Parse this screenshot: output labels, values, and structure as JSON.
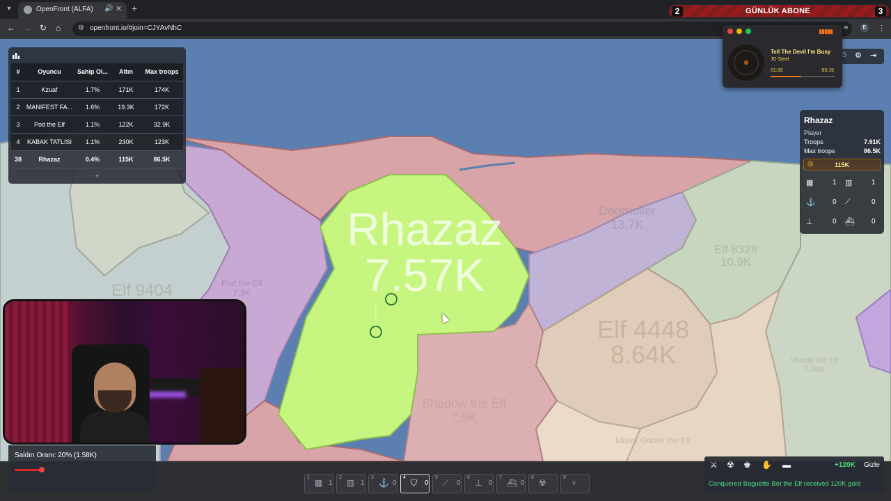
{
  "browser": {
    "tab_title": "OpenFront (ALFA)",
    "url": "openfront.io/#join=CJYAvNhC",
    "profile_initial": "E"
  },
  "banner": {
    "left_number": "2",
    "label": "GÜNLÜK ABONE",
    "right_number": "3"
  },
  "leaderboard": {
    "columns": [
      "#",
      "Oyuncu",
      "Sahip Ol...",
      "Altın",
      "Max troops"
    ],
    "rows": [
      {
        "rank": "1",
        "player": "Kzuaf",
        "owned": "1.7%",
        "gold": "171K",
        "max_troops": "174K"
      },
      {
        "rank": "2",
        "player": "MANIFEST FA...",
        "owned": "1.6%",
        "gold": "19.3K",
        "max_troops": "172K"
      },
      {
        "rank": "3",
        "player": "Pod the Elf",
        "owned": "1.1%",
        "gold": "122K",
        "max_troops": "32.9K"
      },
      {
        "rank": "4",
        "player": "KABAK TATLISI",
        "owned": "1.1%",
        "gold": "230K",
        "max_troops": "123K"
      },
      {
        "rank": "38",
        "player": "Rhazaz",
        "owned": "0.4%",
        "gold": "115K",
        "max_troops": "86.5K"
      }
    ],
    "more_label": "+"
  },
  "music": {
    "song": "Tell The Devil I'm Busy",
    "artist": "JD Steel",
    "current_time": "01:33",
    "total_time": "03:15",
    "progress": 0.48
  },
  "settings_strip": {
    "partial_number": "5"
  },
  "player_panel": {
    "name": "Rhazaz",
    "type": "Player",
    "troops_label": "Troops",
    "troops": "7.91K",
    "max_troops_label": "Max troops",
    "max_troops": "86.5K",
    "gold": "115K",
    "buildings": {
      "city": "1",
      "factory": "1",
      "port": "0",
      "missile_silo": "0",
      "sam": "0",
      "warship": "0"
    }
  },
  "map": {
    "main_name": "Rhazaz",
    "main_troops": "7.57K",
    "labels": [
      {
        "name": "Elf 9404",
        "troops": ""
      },
      {
        "name": "Elf 4448",
        "troops": "8.64K"
      },
      {
        "name": "Elf 8328",
        "troops": "10.9K"
      },
      {
        "name": "Dogmoller",
        "troops": "13.7K"
      },
      {
        "name": "Vexxar the Elf",
        "troops": "7.36K"
      },
      {
        "name": "Pod the Elf",
        "troops": "7.9K"
      },
      {
        "name": "Shadow the Elf",
        "troops": "7.9K"
      },
      {
        "name": "Mister Goblin the Elf",
        "troops": ""
      }
    ]
  },
  "attack": {
    "label": "Saldırı Oranı: 20% (1.58K)",
    "ratio": 0.2
  },
  "build_bar": [
    {
      "key": "1",
      "icon": "city-icon",
      "glyph": "▦",
      "count": "1"
    },
    {
      "key": "2",
      "icon": "factory-icon",
      "glyph": "▥",
      "count": "1"
    },
    {
      "key": "3",
      "icon": "port-icon",
      "glyph": "⚓",
      "count": "0"
    },
    {
      "key": "4",
      "icon": "defense-post-icon",
      "glyph": "⛉",
      "count": "0"
    },
    {
      "key": "5",
      "icon": "missile-silo-icon",
      "glyph": "⟋",
      "count": "0"
    },
    {
      "key": "6",
      "icon": "sam-launcher-icon",
      "glyph": "⊥",
      "count": "0"
    },
    {
      "key": "7",
      "icon": "warship-icon",
      "glyph": "⛴",
      "count": "0"
    },
    {
      "key": "8",
      "icon": "atom-bomb-icon",
      "glyph": "☢",
      "count": ""
    },
    {
      "key": "9",
      "icon": "hydrogen-bomb-icon",
      "glyph": "♆",
      "count": ""
    }
  ],
  "events": {
    "gold_gain": "+120K",
    "hide_label": "Gizle",
    "message": "Conquered Baguette Bot the Elf received 120K gold"
  },
  "colors": {
    "own_territory": "#c6f67f",
    "enemy_red": "#d9a4a8",
    "enemy_purple": "#c7a9d4",
    "ocean": "#5b7fb0",
    "accent_green": "#4ade80"
  }
}
